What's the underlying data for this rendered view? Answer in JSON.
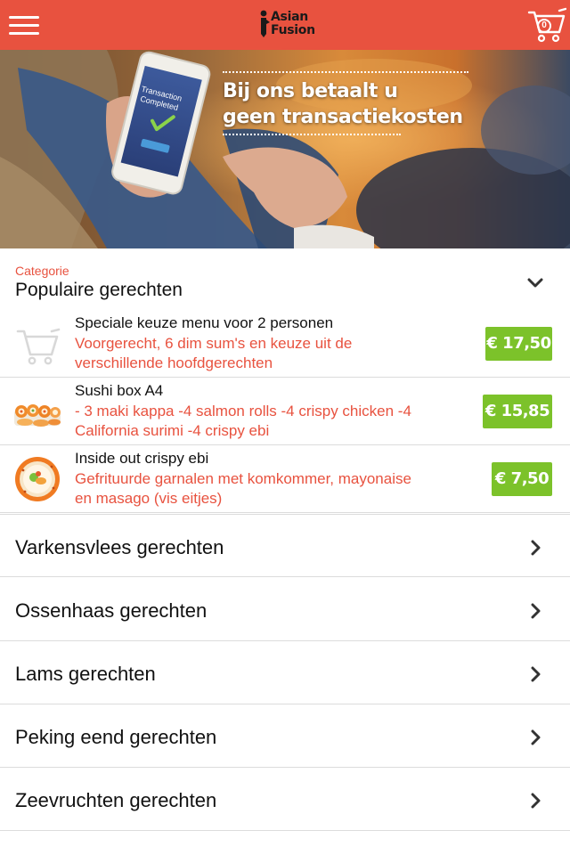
{
  "header": {
    "logo_line1": "Asian",
    "logo_line2": "Fusion",
    "cart_count": "0",
    "icons": {
      "menu": "hamburger-menu-icon",
      "cart": "shopping-cart-icon"
    }
  },
  "hero": {
    "headline_line1": "Bij ons betaalt u",
    "headline_line2": "geen transactiekosten",
    "phone_line1": "Transaction",
    "phone_line2": "Completed"
  },
  "category": {
    "label": "Categorie",
    "selected": "Populaire gerechten",
    "icon": "chevron-down-icon"
  },
  "popular_items": [
    {
      "name": "Speciale keuze menu voor 2 personen",
      "desc_line1": "Voorgerecht, 6 dim sum's en keuze uit de",
      "desc_line2": "verschillende hoofdgerechten",
      "price": "€ 17,50",
      "icon": "cart-placeholder-icon"
    },
    {
      "name": "Sushi box A4",
      "desc_line1": "- 3 maki kappa  -4 salmon rolls  -4 crispy chicken  -4",
      "desc_line2": "California surimi  -4 crispy ebi",
      "price": "€ 15,85",
      "icon": "sushi-box-image"
    },
    {
      "name": "Inside out crispy ebi",
      "desc_line1": "Gefrituurde garnalen met komkommer, mayonaise",
      "desc_line2": "en masago (vis eitjes)",
      "price": "€ 7,50",
      "icon": "sushi-roll-image"
    }
  ],
  "categories": [
    {
      "label": "Varkensvlees gerechten"
    },
    {
      "label": "Ossenhaas gerechten"
    },
    {
      "label": "Lams gerechten"
    },
    {
      "label": "Peking eend gerechten"
    },
    {
      "label": "Zeevruchten gerechten"
    }
  ],
  "colors": {
    "brand_red": "#e8523f",
    "price_green": "#7cc22a",
    "divider": "#dcdcdc"
  }
}
